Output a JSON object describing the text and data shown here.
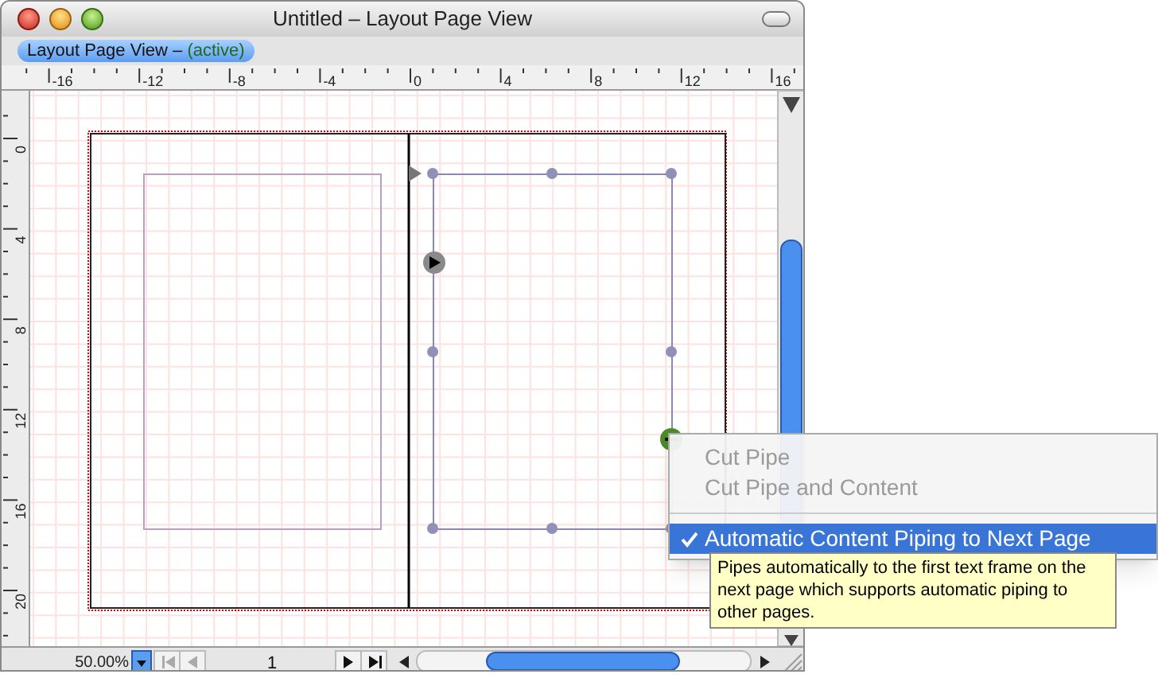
{
  "window": {
    "title": "Untitled – Layout Page View"
  },
  "view_tab": {
    "label": "Layout Page View –",
    "status": "(active)"
  },
  "top_ruler": {
    "labels": [
      "-16",
      "-12",
      "-8",
      "-4",
      "0",
      "4",
      "8",
      "12",
      "16"
    ]
  },
  "left_ruler": {
    "labels": [
      "0",
      "4",
      "8",
      "12",
      "16",
      "20"
    ]
  },
  "context_menu": {
    "items": [
      {
        "kind": "item",
        "label": "Cut Pipe",
        "disabled": true,
        "checked": false,
        "selected": false
      },
      {
        "kind": "item",
        "label": "Cut Pipe and Content",
        "disabled": true,
        "checked": false,
        "selected": false
      },
      {
        "kind": "separator"
      },
      {
        "kind": "item",
        "label": "Automatic Content Piping to Next Page",
        "disabled": false,
        "checked": true,
        "selected": true
      }
    ]
  },
  "tooltip": {
    "text": "Pipes automatically to the first text frame on the next page which supports automatic piping to other pages."
  },
  "bottom_bar": {
    "zoom": "50.00%",
    "page": "1"
  }
}
